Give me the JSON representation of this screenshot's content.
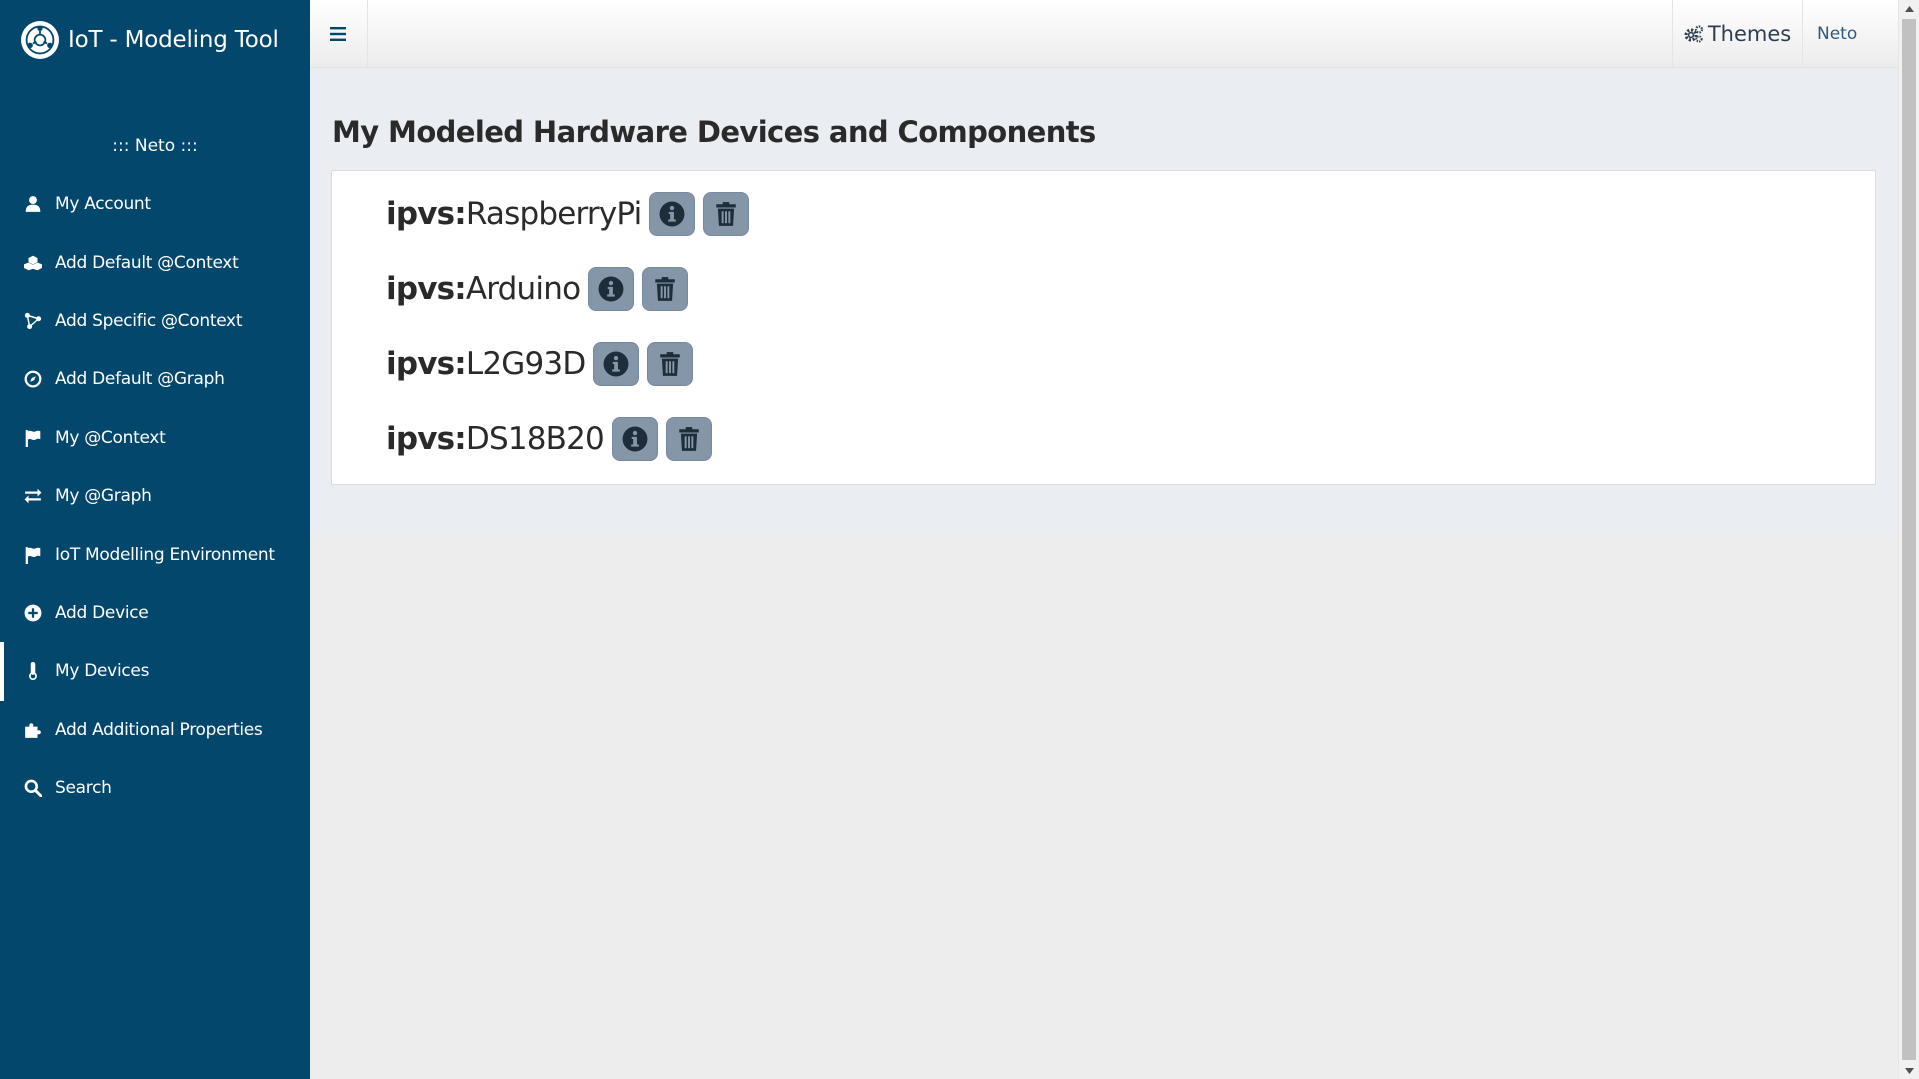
{
  "app": {
    "title": "IoT - Modeling Tool",
    "logo_icon": "iot-logo-icon"
  },
  "sidebar": {
    "user_tag": "::: Neto :::",
    "items": [
      {
        "label": "My Account",
        "icon": "user-icon"
      },
      {
        "label": "Add Default @Context",
        "icon": "cubes-icon"
      },
      {
        "label": "Add Specific @Context",
        "icon": "molecule-icon"
      },
      {
        "label": "Add Default @Graph",
        "icon": "compass-icon"
      },
      {
        "label": "My @Context",
        "icon": "flag-icon"
      },
      {
        "label": "My @Graph",
        "icon": "exchange-icon"
      },
      {
        "label": "IoT Modelling Environment",
        "icon": "flag-icon"
      },
      {
        "label": "Add Device",
        "icon": "plus-circle-icon"
      },
      {
        "label": "My Devices",
        "icon": "thermometer-icon",
        "active": true
      },
      {
        "label": "Add Additional Properties",
        "icon": "puzzle-icon"
      },
      {
        "label": "Search",
        "icon": "search-icon"
      }
    ]
  },
  "topbar": {
    "themes_label": "Themes",
    "user_label": "Neto"
  },
  "main": {
    "title": "My Modeled Hardware Devices and Components",
    "devices": [
      {
        "prefix": "ipvs:",
        "name": "RaspberryPi"
      },
      {
        "prefix": "ipvs:",
        "name": "Arduino"
      },
      {
        "prefix": "ipvs:",
        "name": "L2G93D"
      },
      {
        "prefix": "ipvs:",
        "name": "DS18B20"
      }
    ]
  },
  "colors": {
    "sidebar_bg": "#04476c",
    "button_bg": "#8496a8",
    "page_bg": "#eaedf1"
  }
}
